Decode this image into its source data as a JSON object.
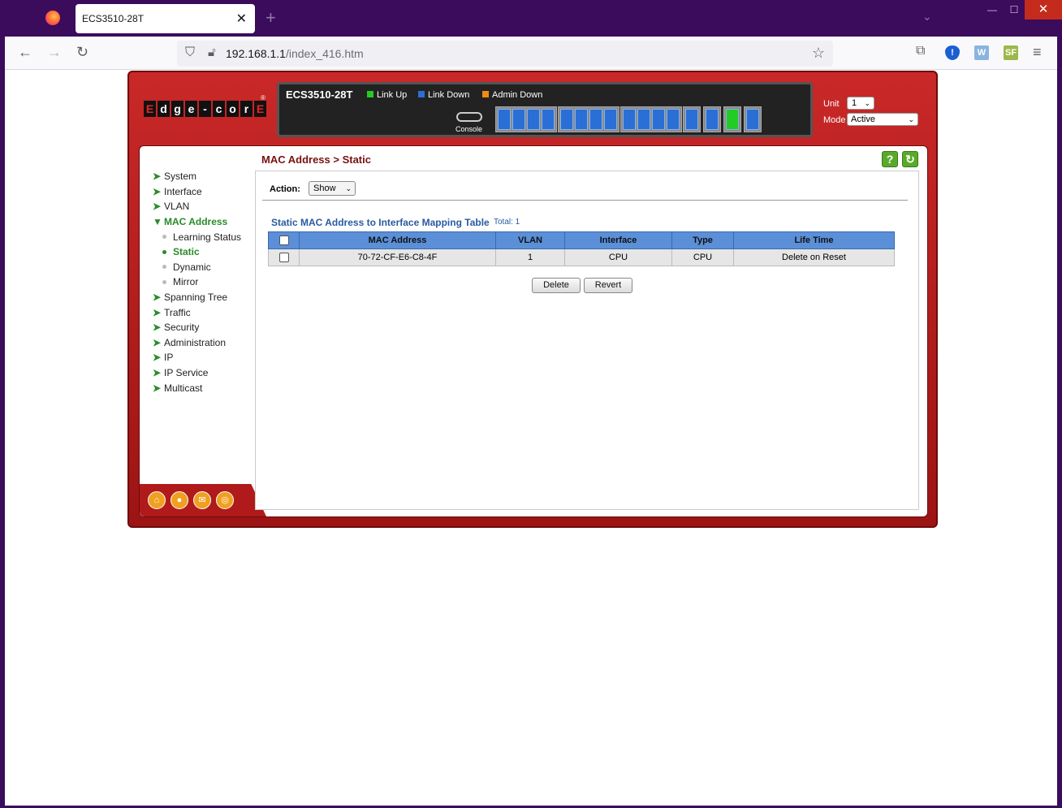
{
  "browser": {
    "tab_title": "ECS3510-28T",
    "url_host": "192.168.1.1",
    "url_path": "/index_416.htm"
  },
  "header": {
    "brand_letters": [
      "E",
      "d",
      "g",
      "e",
      "-",
      "c",
      "o",
      "r",
      "E"
    ],
    "model": "ECS3510-28T",
    "legend": {
      "link_up": "Link Up",
      "link_down": "Link Down",
      "admin_down": "Admin Down"
    },
    "console_label": "Console",
    "unit_label": "Unit",
    "unit_value": "1",
    "mode_label": "Mode",
    "mode_value": "Active",
    "colors": {
      "link_up": "#22cc22",
      "link_down": "#2a6fd6",
      "admin_down": "#f08a10"
    }
  },
  "sidebar": {
    "items": [
      {
        "label": "System"
      },
      {
        "label": "Interface"
      },
      {
        "label": "VLAN"
      },
      {
        "label": "MAC Address",
        "active": true
      },
      {
        "label": "Spanning Tree"
      },
      {
        "label": "Traffic"
      },
      {
        "label": "Security"
      },
      {
        "label": "Administration"
      },
      {
        "label": "IP"
      },
      {
        "label": "IP Service"
      },
      {
        "label": "Multicast"
      }
    ],
    "sub_items": [
      {
        "label": "Learning Status"
      },
      {
        "label": "Static",
        "active": true
      },
      {
        "label": "Dynamic"
      },
      {
        "label": "Mirror"
      }
    ]
  },
  "main": {
    "breadcrumb": "MAC Address > Static",
    "action_label": "Action:",
    "action_value": "Show",
    "table_title": "Static MAC Address to Interface Mapping Table",
    "total": "Total: 1",
    "columns": [
      "MAC Address",
      "VLAN",
      "Interface",
      "Type",
      "Life Time"
    ],
    "rows": [
      {
        "mac": "70-72-CF-E6-C8-4F",
        "vlan": "1",
        "interface": "CPU",
        "type": "CPU",
        "life_time": "Delete on Reset"
      }
    ],
    "delete_label": "Delete",
    "revert_label": "Revert"
  }
}
